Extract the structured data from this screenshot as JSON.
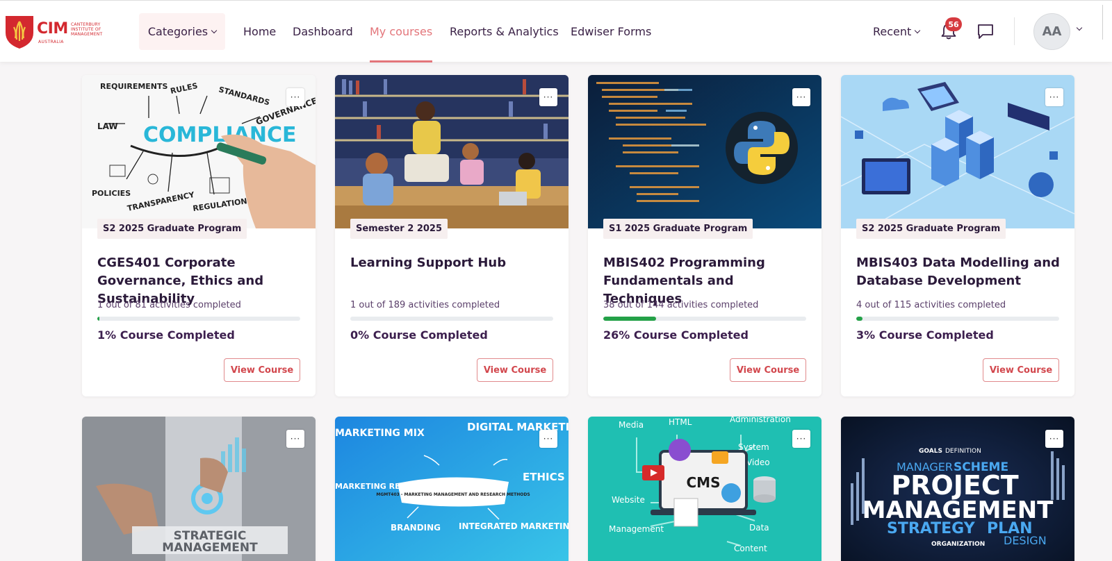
{
  "header": {
    "logo": {
      "main": "CIM",
      "sub": "CANTERBURY INSTITUTE OF MANAGEMENT",
      "country": "AUSTRALIA"
    },
    "categories_label": "Categories",
    "nav": [
      {
        "label": "Home",
        "active": false
      },
      {
        "label": "Dashboard",
        "active": false
      },
      {
        "label": "My courses",
        "active": true
      },
      {
        "label": "Reports & Analytics",
        "active": false
      },
      {
        "label": "Edwiser Forms",
        "active": false
      }
    ],
    "recent_label": "Recent",
    "notification_count": "56",
    "avatar_initials": "AA"
  },
  "courses": [
    {
      "category": "S2 2025 Graduate Program",
      "title": "CGES401 Corporate Governance, Ethics and Sustainability",
      "activities": "1 out of 81 activities completed",
      "progress": 0.01,
      "percent_label": "1% Course Completed",
      "button": "View Course",
      "image": {
        "type": "compliance",
        "words": [
          "REQUIREMENTS",
          "RULES",
          "STANDARDS",
          "LAW",
          "COMPLIANCE",
          "GOVERNANCE",
          "POLICIES",
          "TRANSPARENCY",
          "REGULATIONS"
        ]
      }
    },
    {
      "category": "Semester 2 2025",
      "title": "Learning Support Hub",
      "activities": "1 out of 189 activities completed",
      "progress": 0.0,
      "percent_label": "0% Course Completed",
      "button": "View Course",
      "image": {
        "type": "students"
      }
    },
    {
      "category": "S1 2025 Graduate Program",
      "title": "MBIS402 Programming Fundamentals and Techniques",
      "activities": "38 out of 144 activities completed",
      "progress": 0.26,
      "percent_label": "26% Course Completed",
      "button": "View Course",
      "image": {
        "type": "python"
      }
    },
    {
      "category": "S2 2025 Graduate Program",
      "title": "MBIS403 Data Modelling and Database Development",
      "activities": "4 out of 115 activities completed",
      "progress": 0.03,
      "percent_label": "3% Course Completed",
      "button": "View Course",
      "image": {
        "type": "isometric"
      }
    },
    {
      "image": {
        "type": "strategic",
        "words": [
          "STRATEGIC",
          "MANAGEMENT"
        ]
      }
    },
    {
      "image": {
        "type": "marketing",
        "words": [
          "DIGITAL MARKETING",
          "MARKETING MIX",
          "ETHICS",
          "MARKETING RESEARCH",
          "BRANDING",
          "INTEGRATED MARKETING COMMUNICATIONS",
          "MGMT403 - MARKETING MANAGEMENT AND RESEARCH METHODS"
        ]
      }
    },
    {
      "image": {
        "type": "cms",
        "words": [
          "Media",
          "HTML",
          "Administration",
          "System",
          "Video",
          "Website",
          "CMS",
          "Management",
          "Data",
          "Content"
        ]
      }
    },
    {
      "image": {
        "type": "project",
        "words": [
          "PROJECT",
          "MANAGEMENT",
          "STRATEGY",
          "PLAN",
          "SCHEME",
          "MANAGER",
          "DESIGN",
          "GOALS",
          "DEFINITION",
          "ORGANIZATION"
        ]
      }
    }
  ],
  "colors": {
    "brand_red": "#d3282f",
    "active_nav": "#e3757a",
    "progress_green": "#24a148",
    "button_text": "#d2474d"
  }
}
